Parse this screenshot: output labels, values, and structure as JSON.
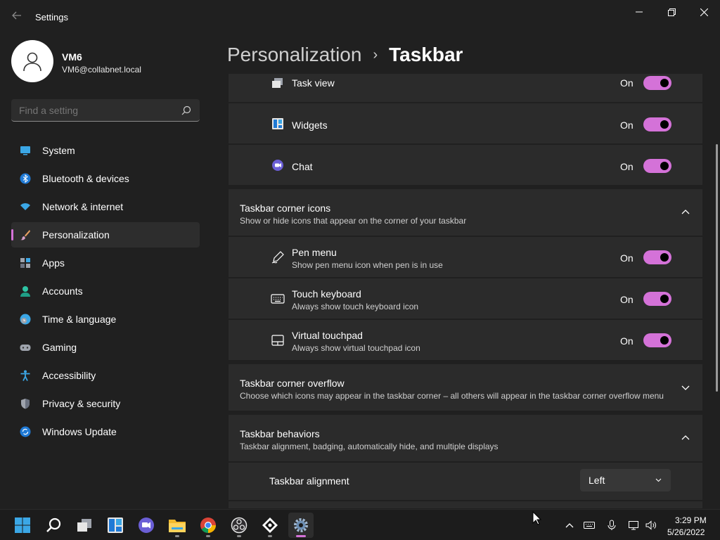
{
  "app": {
    "title": "Settings"
  },
  "profile": {
    "name": "VM6",
    "email": "VM6@collabnet.local"
  },
  "search": {
    "placeholder": "Find a setting"
  },
  "sidebar": {
    "items": [
      {
        "label": "System",
        "icon": "system-icon",
        "active": false
      },
      {
        "label": "Bluetooth & devices",
        "icon": "bluetooth-icon",
        "active": false
      },
      {
        "label": "Network & internet",
        "icon": "wifi-icon",
        "active": false
      },
      {
        "label": "Personalization",
        "icon": "brush-icon",
        "active": true
      },
      {
        "label": "Apps",
        "icon": "apps-icon",
        "active": false
      },
      {
        "label": "Accounts",
        "icon": "accounts-icon",
        "active": false
      },
      {
        "label": "Time & language",
        "icon": "clock-globe-icon",
        "active": false
      },
      {
        "label": "Gaming",
        "icon": "gamepad-icon",
        "active": false
      },
      {
        "label": "Accessibility",
        "icon": "accessibility-icon",
        "active": false
      },
      {
        "label": "Privacy & security",
        "icon": "shield-icon",
        "active": false
      },
      {
        "label": "Windows Update",
        "icon": "update-icon",
        "active": false
      }
    ]
  },
  "header": {
    "parent": "Personalization",
    "separator": "›",
    "current": "Taskbar"
  },
  "taskbar_items": {
    "rows": [
      {
        "title": "Task view",
        "state": "On",
        "icon": "task-view-icon"
      },
      {
        "title": "Widgets",
        "state": "On",
        "icon": "widgets-icon"
      },
      {
        "title": "Chat",
        "state": "On",
        "icon": "chat-icon"
      }
    ]
  },
  "corner_icons": {
    "title": "Taskbar corner icons",
    "desc": "Show or hide icons that appear on the corner of your taskbar",
    "rows": [
      {
        "title": "Pen menu",
        "desc": "Show pen menu icon when pen is in use",
        "state": "On",
        "icon": "pen-icon"
      },
      {
        "title": "Touch keyboard",
        "desc": "Always show touch keyboard icon",
        "state": "On",
        "icon": "keyboard-icon"
      },
      {
        "title": "Virtual touchpad",
        "desc": "Always show virtual touchpad icon",
        "state": "On",
        "icon": "touchpad-icon"
      }
    ]
  },
  "corner_overflow": {
    "title": "Taskbar corner overflow",
    "desc": "Choose which icons may appear in the taskbar corner – all others will appear in the taskbar corner overflow menu"
  },
  "behaviors": {
    "title": "Taskbar behaviors",
    "desc": "Taskbar alignment, badging, automatically hide, and multiple displays",
    "alignment_label": "Taskbar alignment",
    "alignment_value": "Left"
  },
  "tray": {
    "time": "3:29 PM",
    "date": "5/26/2022"
  },
  "colors": {
    "accent": "#d472d8",
    "card": "#2b2b2b",
    "background": "#202020"
  }
}
